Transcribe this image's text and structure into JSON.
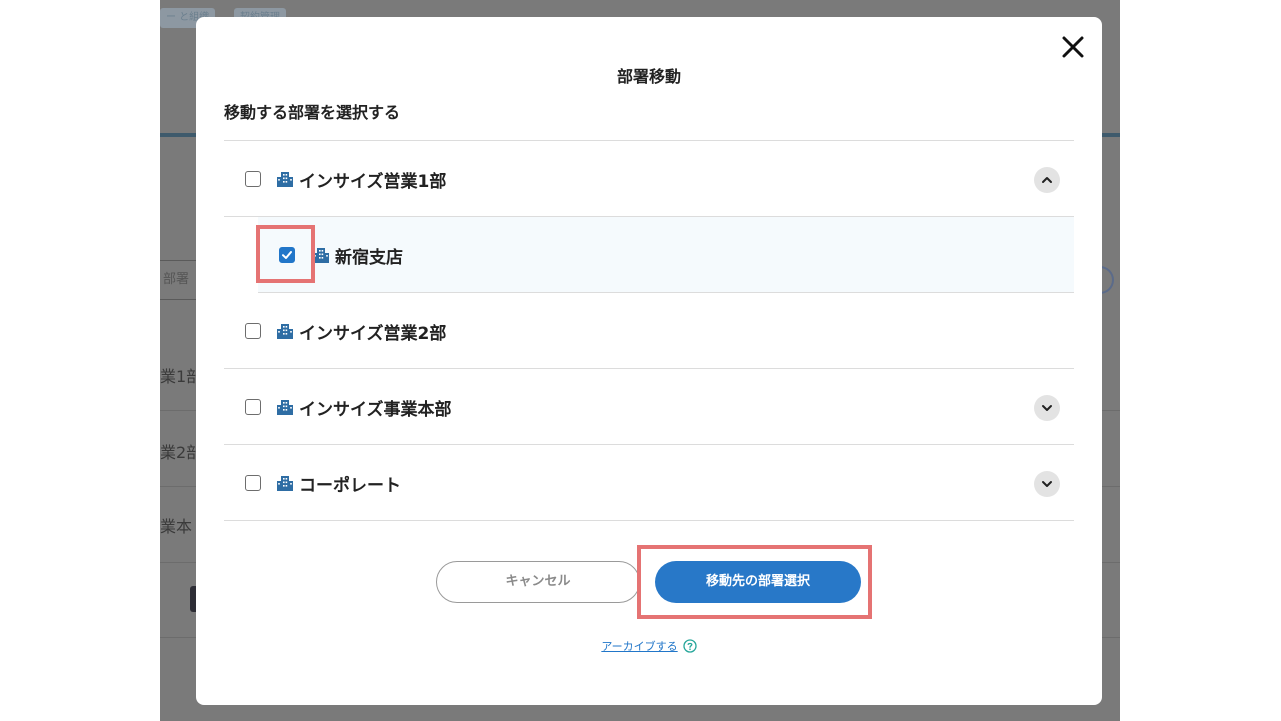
{
  "background": {
    "tabs": [
      "ー と組織",
      "契約管理"
    ],
    "search_placeholder": "部署",
    "rows": [
      "業1部",
      "業2部",
      "業本"
    ]
  },
  "modal": {
    "title": "部署移動",
    "section_label": "移動する部署を選択する",
    "departments": [
      {
        "name": "インサイズ営業1部",
        "checked": false,
        "expand": "collapse",
        "indent": 0
      },
      {
        "name": "新宿支店",
        "checked": true,
        "expand": "none",
        "indent": 1
      },
      {
        "name": "インサイズ営業2部",
        "checked": false,
        "expand": "none",
        "indent": 0
      },
      {
        "name": "インサイズ事業本部",
        "checked": false,
        "expand": "expand",
        "indent": 0
      },
      {
        "name": "コーポレート",
        "checked": false,
        "expand": "expand",
        "indent": 0
      }
    ],
    "cancel_label": "キャンセル",
    "primary_label": "移動先の部署選択",
    "archive_label": "アーカイブする"
  },
  "colors": {
    "accent": "#2878c8",
    "highlight": "#e57373",
    "overlay": "#7a7a7a",
    "dept_icon": "#2e6da4"
  },
  "icons": {
    "close": "close-icon",
    "department": "building-icon",
    "expand": "chevron-down-icon",
    "collapse": "chevron-up-icon",
    "help": "help-circle-icon",
    "check": "check-icon"
  }
}
